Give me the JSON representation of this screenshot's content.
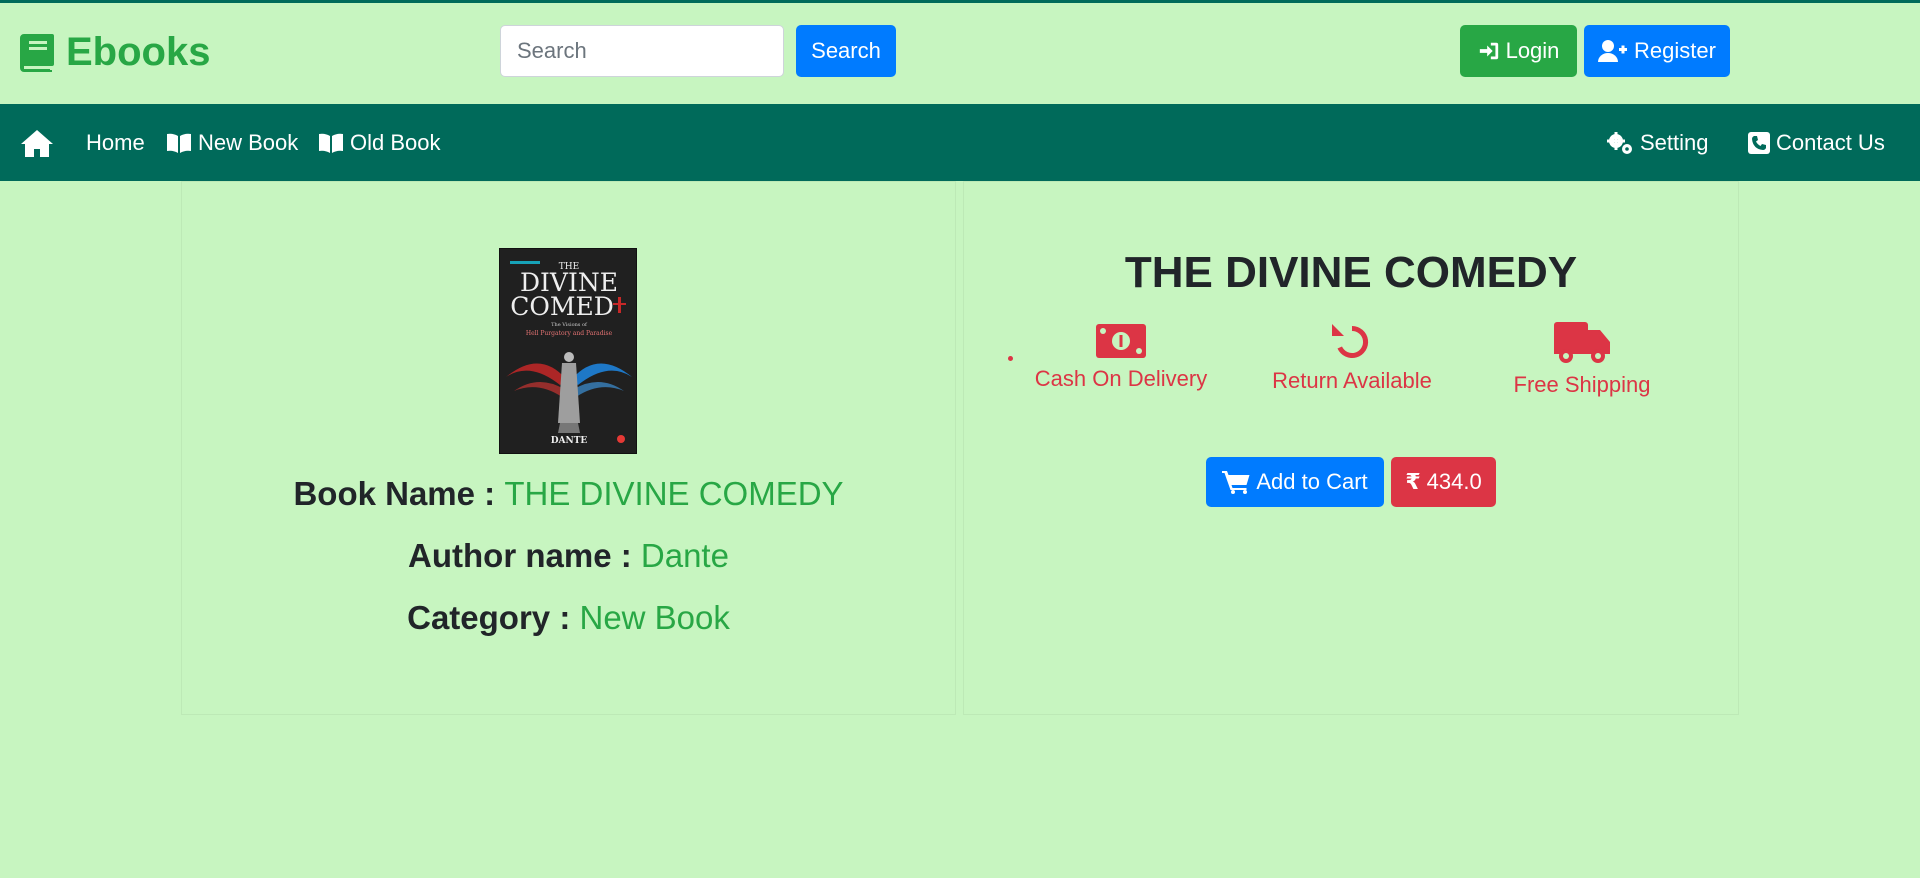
{
  "header": {
    "brand": "Ebooks",
    "search_placeholder": "Search",
    "search_button": "Search",
    "login_button": "Login",
    "register_button": "Register"
  },
  "nav": {
    "home": "Home",
    "new_book": "New Book",
    "old_book": "Old Book",
    "setting": "Setting",
    "contact": "Contact Us"
  },
  "book": {
    "cover": {
      "top": "THE",
      "title_line1": "DIVINE",
      "title_line2": "COMED",
      "subtitle_line1": "The Visions of",
      "subtitle_line2": "Hell Purgatory and Paradise",
      "author": "DANTE"
    },
    "name_label": "Book Name :",
    "name": "THE DIVINE COMEDY",
    "author_label": "Author name :",
    "author": "Dante",
    "category_label": "Category :",
    "category": "New Book"
  },
  "product": {
    "title": "THE DIVINE COMEDY",
    "features": [
      "Cash On Delivery",
      "Return Available",
      "Free Shipping"
    ],
    "add_to_cart": "Add to Cart",
    "price": "434.0",
    "currency_symbol": "₹"
  },
  "colors": {
    "background": "#c7f5c0",
    "navbar": "#006a5a",
    "brand": "#28a745",
    "primary": "#007bff",
    "danger": "#dc3545"
  },
  "icons": {
    "brand": "book-icon",
    "home": "home-icon",
    "new_book": "open-book-icon",
    "old_book": "open-book-icon",
    "setting": "gears-icon",
    "contact": "phone-icon",
    "login": "sign-in-icon",
    "register": "user-plus-icon",
    "cash": "money-icon",
    "return": "undo-icon",
    "shipping": "truck-icon",
    "cart": "cart-icon"
  }
}
